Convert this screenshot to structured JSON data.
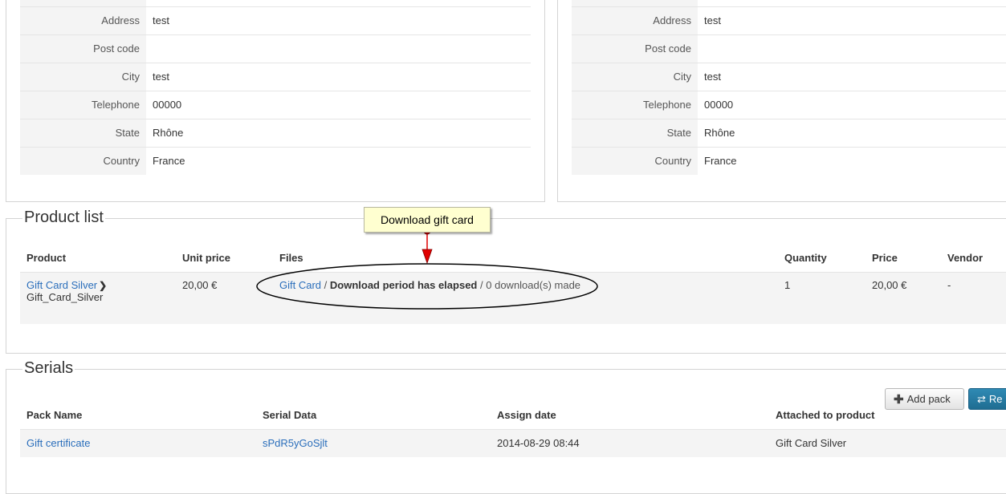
{
  "billing": {
    "fields": [
      {
        "label": "Address",
        "value": "test"
      },
      {
        "label": "Post code",
        "value": ""
      },
      {
        "label": "City",
        "value": "test"
      },
      {
        "label": "Telephone",
        "value": "00000"
      },
      {
        "label": "State",
        "value": "Rhône"
      },
      {
        "label": "Country",
        "value": "France"
      }
    ]
  },
  "shipping": {
    "fields": [
      {
        "label": "Address",
        "value": "test"
      },
      {
        "label": "Post code",
        "value": ""
      },
      {
        "label": "City",
        "value": "test"
      },
      {
        "label": "Telephone",
        "value": "00000"
      },
      {
        "label": "State",
        "value": "Rhône"
      },
      {
        "label": "Country",
        "value": "France"
      }
    ]
  },
  "product_list": {
    "legend": "Product list",
    "headers": {
      "product": "Product",
      "unit_price": "Unit price",
      "files": "Files",
      "quantity": "Quantity",
      "price": "Price",
      "vendor": "Vendor"
    },
    "row": {
      "product_name": "Gift Card Silver",
      "product_code": "Gift_Card_Silver",
      "unit_price": "20,00 €",
      "file_name": "Gift Card",
      "file_status": "Download period has elapsed",
      "downloads": "0 download(s) made",
      "separator": "/",
      "quantity": "1",
      "price": "20,00 €",
      "vendor": "-"
    }
  },
  "serials": {
    "legend": "Serials",
    "add_pack_label": "Add pack",
    "refresh_label": "Re",
    "headers": {
      "pack_name": "Pack Name",
      "serial_data": "Serial Data",
      "assign_date": "Assign date",
      "attached": "Attached to product"
    },
    "row": {
      "pack_name": "Gift certificate",
      "serial_data": "sPdR5yGoSjlt",
      "assign_date": "2014-08-29 08:44",
      "attached": "Gift Card Silver"
    }
  },
  "annotation": {
    "tooltip": "Download gift card",
    "arrow_color": "#e00000"
  }
}
